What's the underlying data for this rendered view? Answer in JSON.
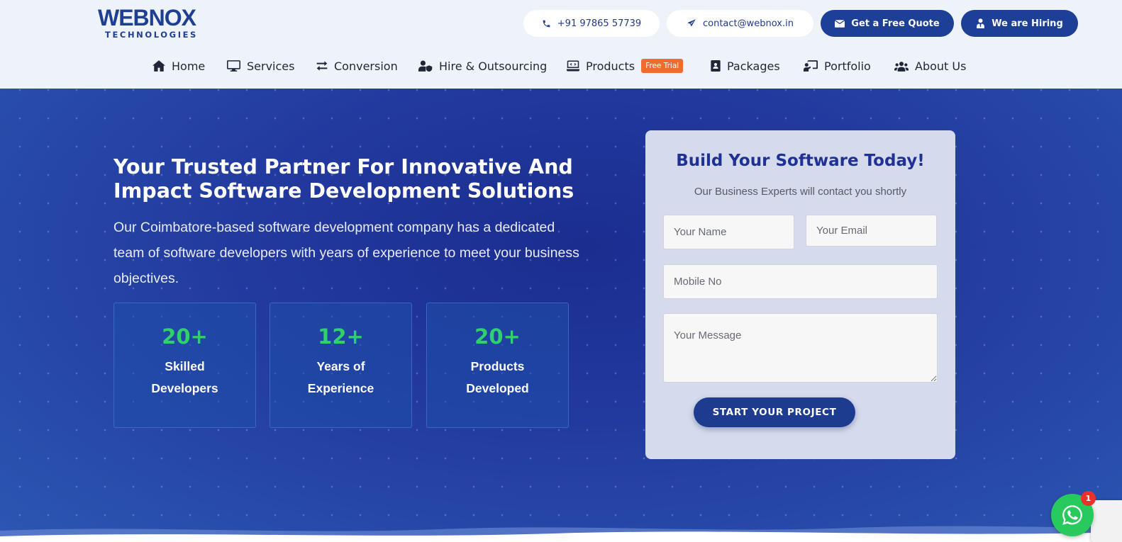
{
  "brand": {
    "logo_text": "WEBNOX",
    "logo_sub": "TECHNOLOGIES"
  },
  "topbar": {
    "phone": "+91 97865 57739",
    "email": "contact@webnox.in",
    "quote_label": "Get a Free Quote",
    "hiring_label": "We are Hiring"
  },
  "nav": {
    "home": "Home",
    "services": "Services",
    "conversion": "Conversion",
    "hire": "Hire & Outsourcing",
    "products": "Products",
    "products_badge": "Free Trial",
    "packages": "Packages",
    "portfolio": "Portfolio",
    "about": "About Us"
  },
  "hero": {
    "title": "Your Trusted Partner For Innovative And Impact Software Development Solutions",
    "description": "Our Coimbatore-based software development company has a dedicated team of software developers with years of experience to meet your business objectives.",
    "stats": [
      {
        "value": "20+",
        "label": "Skilled Developers"
      },
      {
        "value": "12+",
        "label": "Years of Experience"
      },
      {
        "value": "20+",
        "label": "Products Developed"
      }
    ]
  },
  "form": {
    "title": "Build Your Software Today!",
    "subtitle": "Our Business Experts will contact you shortly",
    "name_placeholder": "Your Name",
    "email_placeholder": "Your Email",
    "mobile_placeholder": "Mobile No",
    "message_placeholder": "Your Message",
    "submit_label": "START YOUR PROJECT"
  },
  "chat_widget": {
    "badge_count": "1"
  },
  "colors": {
    "brand_blue": "#1d3f96",
    "accent_green": "#2ed16a",
    "badge_orange": "#f26b2d",
    "whatsapp_green": "#28c95d"
  }
}
